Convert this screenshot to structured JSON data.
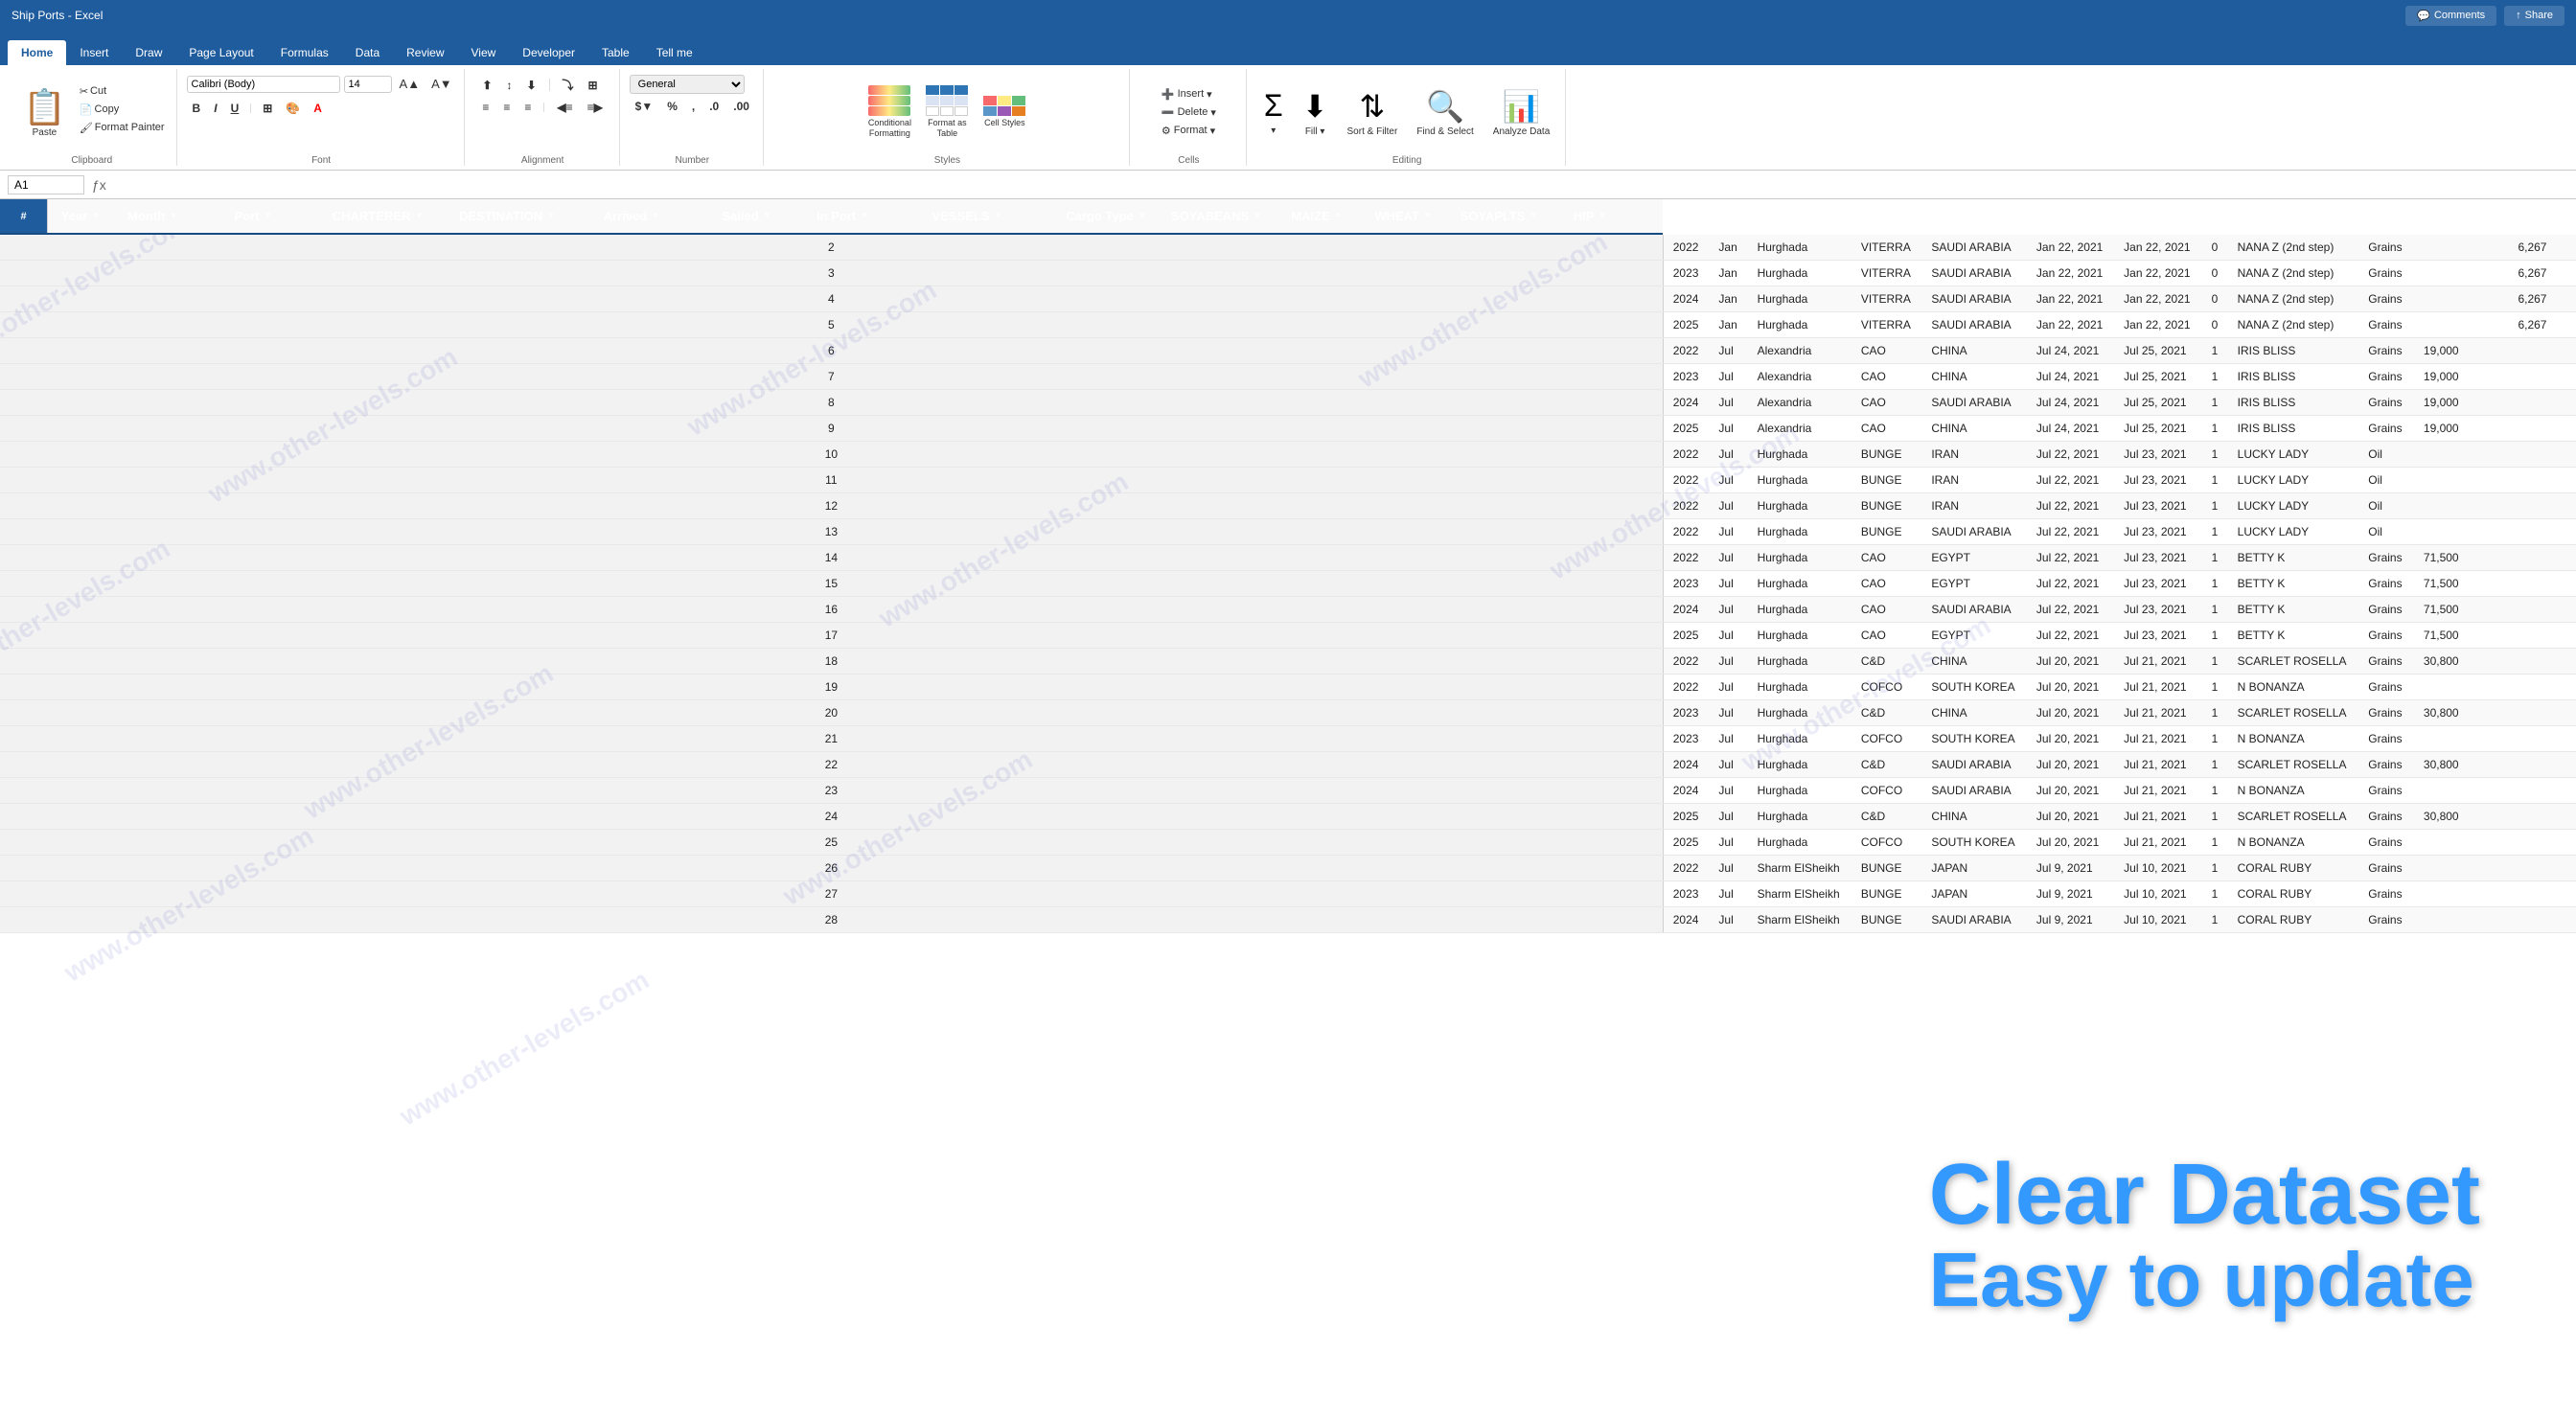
{
  "titleBar": {
    "title": "Ship Ports - Excel",
    "commentsLabel": "Comments",
    "shareLabel": "Share"
  },
  "tabs": [
    {
      "label": "Home",
      "active": true
    },
    {
      "label": "Insert",
      "active": false
    },
    {
      "label": "Draw",
      "active": false
    },
    {
      "label": "Page Layout",
      "active": false
    },
    {
      "label": "Formulas",
      "active": false
    },
    {
      "label": "Data",
      "active": false
    },
    {
      "label": "Review",
      "active": false
    },
    {
      "label": "View",
      "active": false
    },
    {
      "label": "Developer",
      "active": false
    },
    {
      "label": "Table",
      "active": false
    },
    {
      "label": "Tell me",
      "active": false
    }
  ],
  "ribbon": {
    "pasteLabel": "Paste",
    "cutLabel": "Cut",
    "copyLabel": "Copy",
    "formatPainterLabel": "Format Painter",
    "fontName": "Calibri (Body)",
    "fontSize": "14",
    "boldLabel": "B",
    "italicLabel": "I",
    "underlineLabel": "U",
    "fontColorLabel": "A",
    "fillColorLabel": "A",
    "alignmentLabel": "Alignment",
    "numberLabel": "Number",
    "numberFormat": "General",
    "conditionalFormattingLabel": "Conditional Formatting",
    "formatAsTableLabel": "Format as Table",
    "cellStylesLabel": "Cell Styles",
    "insertLabel": "Insert",
    "deleteLabel": "Delete",
    "formatLabel": "Format",
    "cellsGroupLabel": "Cells",
    "sumLabel": "Σ",
    "sortFilterLabel": "Sort & Filter",
    "findSelectLabel": "Find & Select",
    "analyzeDataLabel": "Analyze Data",
    "editingGroupLabel": "Editing"
  },
  "formulaBar": {
    "cellRef": "A1",
    "formula": ""
  },
  "columnHeaders": [
    {
      "label": "Year",
      "width": 70
    },
    {
      "label": "Month",
      "width": 80
    },
    {
      "label": "Port",
      "width": 130
    },
    {
      "label": "CHARTERER",
      "width": 130
    },
    {
      "label": "DESTINATION",
      "width": 140
    },
    {
      "label": "Arrived",
      "width": 120
    },
    {
      "label": "Sailed",
      "width": 120
    },
    {
      "label": "In Port",
      "width": 80
    },
    {
      "label": "VESSELS",
      "width": 180
    },
    {
      "label": "Cargo Type",
      "width": 110
    },
    {
      "label": "SOYABEANS",
      "width": 120
    },
    {
      "label": "MAIZE",
      "width": 90
    },
    {
      "label": "WHEAT",
      "width": 90
    },
    {
      "label": "SOYAPLTS",
      "width": 110
    },
    {
      "label": "HIP",
      "width": 80
    }
  ],
  "rows": [
    {
      "year": "2022",
      "month": "Jan",
      "port": "Hurghada",
      "charterer": "VITERRA",
      "destination": "SAUDI ARABIA",
      "arrived": "Jan 22, 2021",
      "sailed": "Jan 22, 2021",
      "inPort": "0",
      "vessels": "NANA Z (2nd step)",
      "cargoType": "Grains",
      "soyabeans": "",
      "maize": "",
      "wheat": "",
      "soyaplts": "6,267",
      "hip": ""
    },
    {
      "year": "2023",
      "month": "Jan",
      "port": "Hurghada",
      "charterer": "VITERRA",
      "destination": "SAUDI ARABIA",
      "arrived": "Jan 22, 2021",
      "sailed": "Jan 22, 2021",
      "inPort": "0",
      "vessels": "NANA Z (2nd step)",
      "cargoType": "Grains",
      "soyabeans": "",
      "maize": "",
      "wheat": "",
      "soyaplts": "6,267",
      "hip": ""
    },
    {
      "year": "2024",
      "month": "Jan",
      "port": "Hurghada",
      "charterer": "VITERRA",
      "destination": "SAUDI ARABIA",
      "arrived": "Jan 22, 2021",
      "sailed": "Jan 22, 2021",
      "inPort": "0",
      "vessels": "NANA Z (2nd step)",
      "cargoType": "Grains",
      "soyabeans": "",
      "maize": "",
      "wheat": "",
      "soyaplts": "6,267",
      "hip": ""
    },
    {
      "year": "2025",
      "month": "Jan",
      "port": "Hurghada",
      "charterer": "VITERRA",
      "destination": "SAUDI ARABIA",
      "arrived": "Jan 22, 2021",
      "sailed": "Jan 22, 2021",
      "inPort": "0",
      "vessels": "NANA Z (2nd step)",
      "cargoType": "Grains",
      "soyabeans": "",
      "maize": "",
      "wheat": "",
      "soyaplts": "6,267",
      "hip": ""
    },
    {
      "year": "2022",
      "month": "Jul",
      "port": "Alexandria",
      "charterer": "CAO",
      "destination": "CHINA",
      "arrived": "Jul 24, 2021",
      "sailed": "Jul 25, 2021",
      "inPort": "1",
      "vessels": "IRIS BLISS",
      "cargoType": "Grains",
      "soyabeans": "19,000",
      "maize": "",
      "wheat": "",
      "soyaplts": "",
      "hip": ""
    },
    {
      "year": "2023",
      "month": "Jul",
      "port": "Alexandria",
      "charterer": "CAO",
      "destination": "CHINA",
      "arrived": "Jul 24, 2021",
      "sailed": "Jul 25, 2021",
      "inPort": "1",
      "vessels": "IRIS BLISS",
      "cargoType": "Grains",
      "soyabeans": "19,000",
      "maize": "",
      "wheat": "",
      "soyaplts": "",
      "hip": ""
    },
    {
      "year": "2024",
      "month": "Jul",
      "port": "Alexandria",
      "charterer": "CAO",
      "destination": "SAUDI ARABIA",
      "arrived": "Jul 24, 2021",
      "sailed": "Jul 25, 2021",
      "inPort": "1",
      "vessels": "IRIS BLISS",
      "cargoType": "Grains",
      "soyabeans": "19,000",
      "maize": "",
      "wheat": "",
      "soyaplts": "",
      "hip": ""
    },
    {
      "year": "2025",
      "month": "Jul",
      "port": "Alexandria",
      "charterer": "CAO",
      "destination": "CHINA",
      "arrived": "Jul 24, 2021",
      "sailed": "Jul 25, 2021",
      "inPort": "1",
      "vessels": "IRIS BLISS",
      "cargoType": "Grains",
      "soyabeans": "19,000",
      "maize": "",
      "wheat": "",
      "soyaplts": "",
      "hip": ""
    },
    {
      "year": "2022",
      "month": "Jul",
      "port": "Hurghada",
      "charterer": "BUNGE",
      "destination": "IRAN",
      "arrived": "Jul 22, 2021",
      "sailed": "Jul 23, 2021",
      "inPort": "1",
      "vessels": "LUCKY LADY",
      "cargoType": "Oil",
      "soyabeans": "",
      "maize": "",
      "wheat": "",
      "soyaplts": "",
      "hip": ""
    },
    {
      "year": "2022",
      "month": "Jul",
      "port": "Hurghada",
      "charterer": "BUNGE",
      "destination": "IRAN",
      "arrived": "Jul 22, 2021",
      "sailed": "Jul 23, 2021",
      "inPort": "1",
      "vessels": "LUCKY LADY",
      "cargoType": "Oil",
      "soyabeans": "",
      "maize": "",
      "wheat": "",
      "soyaplts": "",
      "hip": ""
    },
    {
      "year": "2022",
      "month": "Jul",
      "port": "Hurghada",
      "charterer": "BUNGE",
      "destination": "IRAN",
      "arrived": "Jul 22, 2021",
      "sailed": "Jul 23, 2021",
      "inPort": "1",
      "vessels": "LUCKY LADY",
      "cargoType": "Oil",
      "soyabeans": "",
      "maize": "",
      "wheat": "",
      "soyaplts": "",
      "hip": ""
    },
    {
      "year": "2022",
      "month": "Jul",
      "port": "Hurghada",
      "charterer": "BUNGE",
      "destination": "SAUDI ARABIA",
      "arrived": "Jul 22, 2021",
      "sailed": "Jul 23, 2021",
      "inPort": "1",
      "vessels": "LUCKY LADY",
      "cargoType": "Oil",
      "soyabeans": "",
      "maize": "",
      "wheat": "",
      "soyaplts": "",
      "hip": ""
    },
    {
      "year": "2022",
      "month": "Jul",
      "port": "Hurghada",
      "charterer": "CAO",
      "destination": "EGYPT",
      "arrived": "Jul 22, 2021",
      "sailed": "Jul 23, 2021",
      "inPort": "1",
      "vessels": "BETTY K",
      "cargoType": "Grains",
      "soyabeans": "71,500",
      "maize": "",
      "wheat": "",
      "soyaplts": "",
      "hip": ""
    },
    {
      "year": "2023",
      "month": "Jul",
      "port": "Hurghada",
      "charterer": "CAO",
      "destination": "EGYPT",
      "arrived": "Jul 22, 2021",
      "sailed": "Jul 23, 2021",
      "inPort": "1",
      "vessels": "BETTY K",
      "cargoType": "Grains",
      "soyabeans": "71,500",
      "maize": "",
      "wheat": "",
      "soyaplts": "",
      "hip": ""
    },
    {
      "year": "2024",
      "month": "Jul",
      "port": "Hurghada",
      "charterer": "CAO",
      "destination": "SAUDI ARABIA",
      "arrived": "Jul 22, 2021",
      "sailed": "Jul 23, 2021",
      "inPort": "1",
      "vessels": "BETTY K",
      "cargoType": "Grains",
      "soyabeans": "71,500",
      "maize": "",
      "wheat": "",
      "soyaplts": "",
      "hip": ""
    },
    {
      "year": "2025",
      "month": "Jul",
      "port": "Hurghada",
      "charterer": "CAO",
      "destination": "EGYPT",
      "arrived": "Jul 22, 2021",
      "sailed": "Jul 23, 2021",
      "inPort": "1",
      "vessels": "BETTY K",
      "cargoType": "Grains",
      "soyabeans": "71,500",
      "maize": "",
      "wheat": "",
      "soyaplts": "",
      "hip": ""
    },
    {
      "year": "2022",
      "month": "Jul",
      "port": "Hurghada",
      "charterer": "C&D",
      "destination": "CHINA",
      "arrived": "Jul 20, 2021",
      "sailed": "Jul 21, 2021",
      "inPort": "1",
      "vessels": "SCARLET ROSELLA",
      "cargoType": "Grains",
      "soyabeans": "30,800",
      "maize": "",
      "wheat": "",
      "soyaplts": "",
      "hip": ""
    },
    {
      "year": "2022",
      "month": "Jul",
      "port": "Hurghada",
      "charterer": "COFCO",
      "destination": "SOUTH KOREA",
      "arrived": "Jul 20, 2021",
      "sailed": "Jul 21, 2021",
      "inPort": "1",
      "vessels": "N BONANZA",
      "cargoType": "Grains",
      "soyabeans": "",
      "maize": "",
      "wheat": "",
      "soyaplts": "",
      "hip": ""
    },
    {
      "year": "2023",
      "month": "Jul",
      "port": "Hurghada",
      "charterer": "C&D",
      "destination": "CHINA",
      "arrived": "Jul 20, 2021",
      "sailed": "Jul 21, 2021",
      "inPort": "1",
      "vessels": "SCARLET ROSELLA",
      "cargoType": "Grains",
      "soyabeans": "30,800",
      "maize": "",
      "wheat": "",
      "soyaplts": "",
      "hip": ""
    },
    {
      "year": "2023",
      "month": "Jul",
      "port": "Hurghada",
      "charterer": "COFCO",
      "destination": "SOUTH KOREA",
      "arrived": "Jul 20, 2021",
      "sailed": "Jul 21, 2021",
      "inPort": "1",
      "vessels": "N BONANZA",
      "cargoType": "Grains",
      "soyabeans": "",
      "maize": "",
      "wheat": "",
      "soyaplts": "",
      "hip": ""
    },
    {
      "year": "2024",
      "month": "Jul",
      "port": "Hurghada",
      "charterer": "C&D",
      "destination": "SAUDI ARABIA",
      "arrived": "Jul 20, 2021",
      "sailed": "Jul 21, 2021",
      "inPort": "1",
      "vessels": "SCARLET ROSELLA",
      "cargoType": "Grains",
      "soyabeans": "30,800",
      "maize": "",
      "wheat": "",
      "soyaplts": "",
      "hip": ""
    },
    {
      "year": "2024",
      "month": "Jul",
      "port": "Hurghada",
      "charterer": "COFCO",
      "destination": "SAUDI ARABIA",
      "arrived": "Jul 20, 2021",
      "sailed": "Jul 21, 2021",
      "inPort": "1",
      "vessels": "N BONANZA",
      "cargoType": "Grains",
      "soyabeans": "",
      "maize": "",
      "wheat": "",
      "soyaplts": "",
      "hip": ""
    },
    {
      "year": "2025",
      "month": "Jul",
      "port": "Hurghada",
      "charterer": "C&D",
      "destination": "CHINA",
      "arrived": "Jul 20, 2021",
      "sailed": "Jul 21, 2021",
      "inPort": "1",
      "vessels": "SCARLET ROSELLA",
      "cargoType": "Grains",
      "soyabeans": "30,800",
      "maize": "",
      "wheat": "",
      "soyaplts": "",
      "hip": ""
    },
    {
      "year": "2025",
      "month": "Jul",
      "port": "Hurghada",
      "charterer": "COFCO",
      "destination": "SOUTH KOREA",
      "arrived": "Jul 20, 2021",
      "sailed": "Jul 21, 2021",
      "inPort": "1",
      "vessels": "N BONANZA",
      "cargoType": "Grains",
      "soyabeans": "",
      "maize": "",
      "wheat": "",
      "soyaplts": "",
      "hip": ""
    },
    {
      "year": "2022",
      "month": "Jul",
      "port": "Sharm ElSheikh",
      "charterer": "BUNGE",
      "destination": "JAPAN",
      "arrived": "Jul 9, 2021",
      "sailed": "Jul 10, 2021",
      "inPort": "1",
      "vessels": "CORAL RUBY",
      "cargoType": "Grains",
      "soyabeans": "",
      "maize": "",
      "wheat": "",
      "soyaplts": "",
      "hip": ""
    },
    {
      "year": "2023",
      "month": "Jul",
      "port": "Sharm ElSheikh",
      "charterer": "BUNGE",
      "destination": "JAPAN",
      "arrived": "Jul 9, 2021",
      "sailed": "Jul 10, 2021",
      "inPort": "1",
      "vessels": "CORAL RUBY",
      "cargoType": "Grains",
      "soyabeans": "",
      "maize": "",
      "wheat": "",
      "soyaplts": "",
      "hip": ""
    },
    {
      "year": "2024",
      "month": "Jul",
      "port": "Sharm ElSheikh",
      "charterer": "BUNGE",
      "destination": "SAUDI ARABIA",
      "arrived": "Jul 9, 2021",
      "sailed": "Jul 10, 2021",
      "inPort": "1",
      "vessels": "CORAL RUBY",
      "cargoType": "Grains",
      "soyabeans": "",
      "maize": "",
      "wheat": "",
      "soyaplts": "",
      "hip": ""
    }
  ],
  "promo": {
    "line1": "Clear Dataset",
    "line2": "Easy to update"
  },
  "watermarkText": "www.other-levels.com"
}
